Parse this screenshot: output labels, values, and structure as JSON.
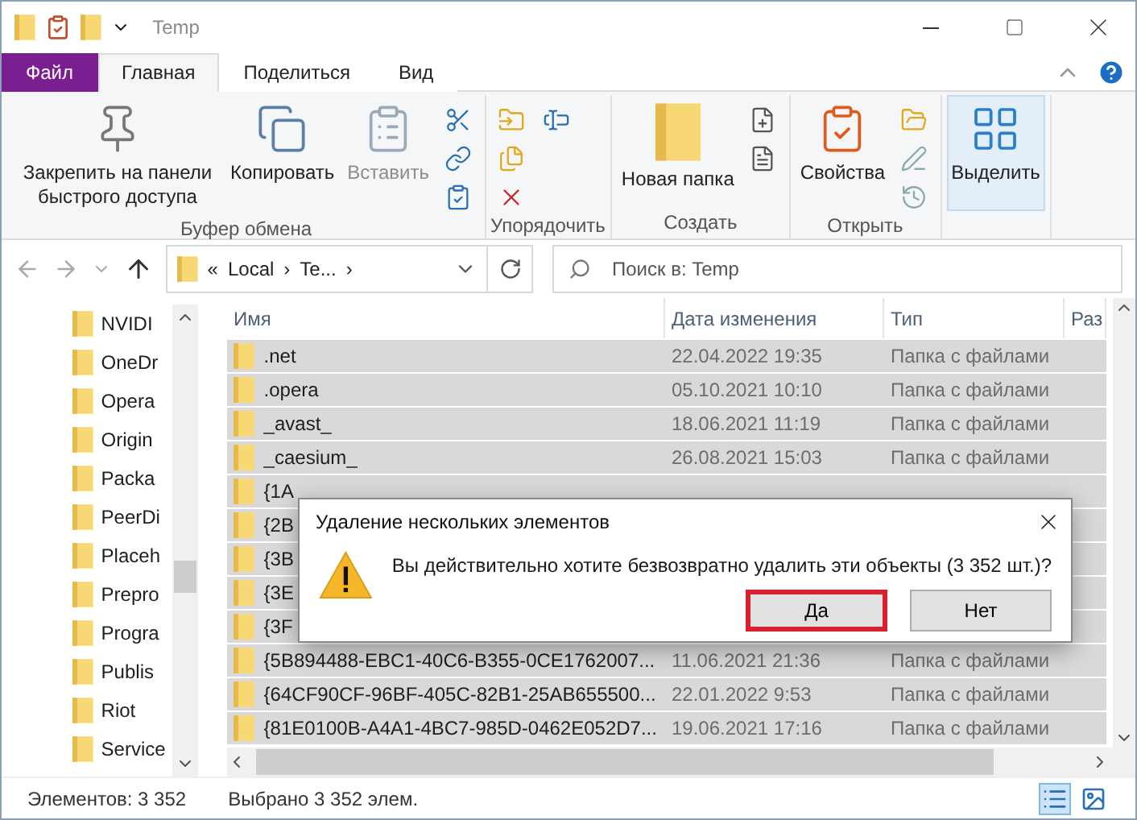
{
  "window": {
    "title": "Temp"
  },
  "tabs": [
    {
      "label": "Файл",
      "kind": "file",
      "selected": false
    },
    {
      "label": "Главная",
      "kind": "tab",
      "selected": true
    },
    {
      "label": "Поделиться",
      "kind": "tab",
      "selected": false
    },
    {
      "label": "Вид",
      "kind": "tab",
      "selected": false
    }
  ],
  "ribbon": [
    {
      "label": "Буфер обмена",
      "buttons": [
        {
          "kind": "large",
          "label": "Закрепить на панели быстрого доступа",
          "disabled": false,
          "active": false
        },
        {
          "kind": "large",
          "label": "Копировать",
          "disabled": false,
          "active": false
        },
        {
          "kind": "large",
          "label": "Вставить",
          "disabled": true,
          "active": false
        },
        {
          "kind": "small"
        },
        {
          "kind": "small"
        },
        {
          "kind": "small"
        }
      ]
    },
    {
      "label": "Упорядочить",
      "buttons": [
        {
          "kind": "small"
        },
        {
          "kind": "small"
        },
        {
          "kind": "small"
        },
        {
          "kind": "small"
        }
      ]
    },
    {
      "label": "Создать",
      "buttons": [
        {
          "kind": "large",
          "label": "Новая папка",
          "disabled": false,
          "active": false
        },
        {
          "kind": "small"
        },
        {
          "kind": "small"
        }
      ]
    },
    {
      "label": "Открыть",
      "buttons": [
        {
          "kind": "large",
          "label": "Свойства",
          "disabled": false,
          "active": false
        },
        {
          "kind": "small"
        },
        {
          "kind": "small"
        },
        {
          "kind": "small"
        }
      ]
    },
    {
      "buttons": [
        {
          "kind": "large",
          "label": "Выделить",
          "disabled": false,
          "active": true
        }
      ]
    }
  ],
  "address": {
    "crumbs": [
      "«",
      "Local",
      "›",
      "Te...",
      "›"
    ]
  },
  "search": {
    "placeholder": "Поиск в: Temp"
  },
  "nav_pane": [
    "NVIDI",
    "OneDr",
    "Opera",
    "Origin",
    "Packa",
    "PeerDi",
    "Placeh",
    "Prepro",
    "Progra",
    "Publis",
    "Riot",
    "Service"
  ],
  "columns": [
    "Имя",
    "Дата изменения",
    "Тип",
    "Раз"
  ],
  "rows": [
    {
      "name": ".net",
      "date": "22.04.2022 19:35",
      "type": "Папка с файлами",
      "selected": true
    },
    {
      "name": ".opera",
      "date": "05.10.2021 10:10",
      "type": "Папка с файлами",
      "selected": true
    },
    {
      "name": "_avast_",
      "date": "18.06.2021 11:19",
      "type": "Папка с файлами",
      "selected": true
    },
    {
      "name": "_caesium_",
      "date": "26.08.2021 15:03",
      "type": "Папка с файлами",
      "selected": true
    },
    {
      "name": "{1A",
      "selected": true
    },
    {
      "name": "{2B",
      "selected": true
    },
    {
      "name": "{3B",
      "selected": true
    },
    {
      "name": "{3E",
      "selected": true
    },
    {
      "name": "{3F",
      "selected": true
    },
    {
      "name": "{5B894488-EBC1-40C6-B355-0CE1762007...",
      "date": "11.06.2021 21:36",
      "type": "Папка с файлами",
      "selected": true
    },
    {
      "name": "{64CF90CF-96BF-405C-82B1-25AB655500...",
      "date": "22.01.2022 9:53",
      "type": "Папка с файлами",
      "selected": true
    },
    {
      "name": "{81E0100B-A4A1-4BC7-985D-0462E052D7...",
      "date": "19.06.2021 17:16",
      "type": "Папка с файлами",
      "selected": true
    }
  ],
  "status_bar": {
    "count": "Элементов: 3 352",
    "selection": "Выбрано 3 352 элем."
  },
  "dialog": {
    "title": "Удаление нескольких элементов",
    "message": "Вы действительно хотите безвозвратно удалить эти объекты (3 352 шт.)?",
    "buttons": [
      {
        "label": "Да",
        "highlighted": true
      },
      {
        "label": "Нет",
        "highlighted": false
      }
    ]
  }
}
